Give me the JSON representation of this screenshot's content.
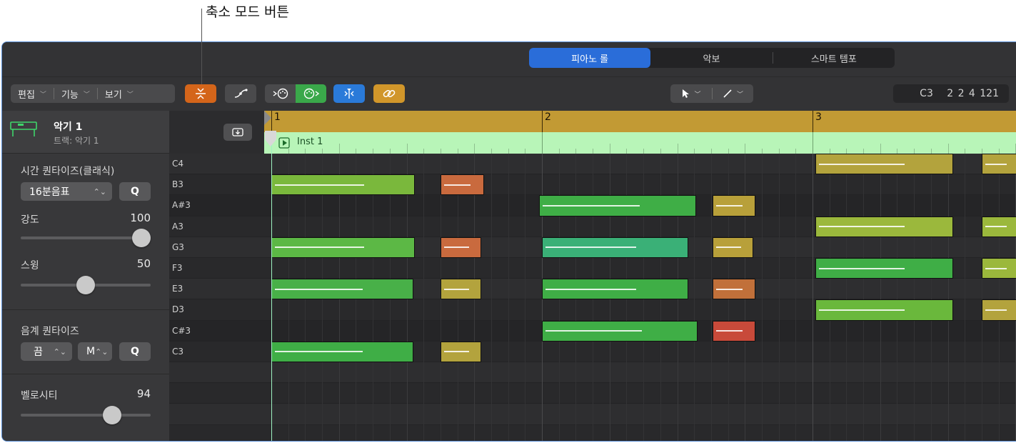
{
  "callout": {
    "label": "축소 모드 버튼"
  },
  "view_tabs": [
    {
      "label": "피아노 롤",
      "active": true
    },
    {
      "label": "악보",
      "active": false
    },
    {
      "label": "스마트 템포",
      "active": false
    }
  ],
  "menus": [
    {
      "label": "편집"
    },
    {
      "label": "기능"
    },
    {
      "label": "보기"
    }
  ],
  "toolbar_icons": {
    "collapse": "collapse-mode-icon",
    "automation": "automation-curve-icon",
    "midi_in": "midi-in-icon",
    "midi_out": "midi-out-icon",
    "catch": "catch-playhead-icon",
    "link": "link-icon",
    "pointer_tool": "pointer-tool-icon",
    "pencil_tool": "pencil-tool-icon"
  },
  "colors": {
    "accent": "#2a6dd9",
    "collapse": "#d4651a",
    "midi_out": "#3aa84a",
    "catch": "#2a7ad9",
    "link": "#d1962a",
    "ruler": "#c29a34",
    "region": "#b8f5b8"
  },
  "readout": {
    "text": "C3   2 2 4 121"
  },
  "track": {
    "name": "악기 1",
    "subtitle": "트랙: 악기 1"
  },
  "time_quantize": {
    "label": "시간 퀀타이즈(클래식)",
    "value": "16분음표",
    "q": "Q",
    "strength_label": "강도",
    "strength_value": "100",
    "strength": 100,
    "swing_label": "스윙",
    "swing_value": "50",
    "swing": 50
  },
  "scale_quantize": {
    "label": "음계 퀀타이즈",
    "value1": "끔",
    "value2": "M",
    "q": "Q"
  },
  "velocity": {
    "label": "벨로시티",
    "value": "94",
    "level": 94
  },
  "ruler": {
    "bars": [
      "1",
      "2",
      "3"
    ]
  },
  "region": {
    "name": "Inst 1"
  },
  "keys": [
    "C4",
    "B3",
    "A#3",
    "A3",
    "G3",
    "F3",
    "E3",
    "D3",
    "C#3",
    "C3"
  ],
  "notes": [
    {
      "row": 1,
      "start": 1.0,
      "len": 0.53,
      "color": "#7ab83c"
    },
    {
      "row": 1,
      "start": 1.625,
      "len": 0.16,
      "color": "#c96a3e"
    },
    {
      "row": 4,
      "start": 1.0,
      "len": 0.53,
      "color": "#5cb845"
    },
    {
      "row": 4,
      "start": 1.625,
      "len": 0.15,
      "color": "#c96a3e"
    },
    {
      "row": 6,
      "start": 1.0,
      "len": 0.525,
      "color": "#48b048"
    },
    {
      "row": 6,
      "start": 1.625,
      "len": 0.15,
      "color": "#b3a33d"
    },
    {
      "row": 9,
      "start": 1.0,
      "len": 0.525,
      "color": "#3fae46"
    },
    {
      "row": 9,
      "start": 1.625,
      "len": 0.15,
      "color": "#b3a33d"
    },
    {
      "row": 2,
      "start": 1.99,
      "len": 0.58,
      "color": "#3fae46"
    },
    {
      "row": 2,
      "start": 2.63,
      "len": 0.16,
      "color": "#b8a03a"
    },
    {
      "row": 4,
      "start": 2.0,
      "len": 0.54,
      "color": "#3ab077"
    },
    {
      "row": 4,
      "start": 2.63,
      "len": 0.15,
      "color": "#b8a03a"
    },
    {
      "row": 6,
      "start": 2.0,
      "len": 0.54,
      "color": "#3fae46"
    },
    {
      "row": 6,
      "start": 2.63,
      "len": 0.16,
      "color": "#c1703a"
    },
    {
      "row": 8,
      "start": 2.0,
      "len": 0.575,
      "color": "#3fae46"
    },
    {
      "row": 8,
      "start": 2.63,
      "len": 0.16,
      "color": "#c84a3a"
    },
    {
      "row": 0,
      "start": 3.01,
      "len": 0.51,
      "color": "#b3a33d"
    },
    {
      "row": 0,
      "start": 3.625,
      "len": 0.13,
      "color": "#b3a33d"
    },
    {
      "row": 3,
      "start": 3.01,
      "len": 0.51,
      "color": "#9bb83c"
    },
    {
      "row": 3,
      "start": 3.625,
      "len": 0.13,
      "color": "#9bb83c"
    },
    {
      "row": 5,
      "start": 3.01,
      "len": 0.51,
      "color": "#3fae46"
    },
    {
      "row": 5,
      "start": 3.625,
      "len": 0.13,
      "color": "#9bb83c"
    },
    {
      "row": 7,
      "start": 3.01,
      "len": 0.51,
      "color": "#6ab83c"
    },
    {
      "row": 7,
      "start": 3.625,
      "len": 0.13,
      "color": "#b3a33d"
    }
  ]
}
